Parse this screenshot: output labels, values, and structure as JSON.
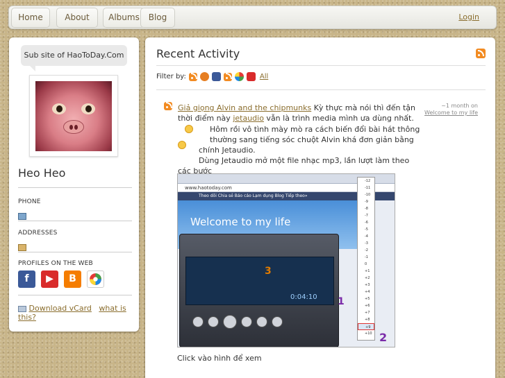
{
  "nav": {
    "items": [
      "Home",
      "About",
      "Albums",
      "Blog"
    ],
    "login": "Login"
  },
  "sidebar": {
    "site_note": "Sub site of HaoToDay.Com",
    "name": "Heo Heo",
    "phone_label": "PHONE",
    "addresses_label": "ADDRESSES",
    "profiles_label": "PROFILES ON THE WEB",
    "download_vcard": "Download vCard",
    "what_is_this": "what is this?"
  },
  "main": {
    "title": "Recent Activity",
    "filter_label": "Filter by:",
    "filter_all": "All"
  },
  "post": {
    "title_link": "Giả giọng Alvin and the chipmunks",
    "text1": " Kỳ thực mà nói thì đến tận thời điểm này ",
    "app_link": "jetaudio",
    "text2": " vẫn là trình media mình ưa dùng nhất.",
    "text3": "Hôm rồi vô tình mày mò ra cách biến đổi bài hát thông thường sang tiếng sóc chuột Alvin khá đơn giản bằng",
    "text4": "chính Jetaudio.",
    "text5": "Dùng Jetaudio mở một file nhạc mp3, lần lượt làm theo các bước",
    "time": "~1 month on",
    "via": "Welcome to my life",
    "caption": "Click vào hình để xem"
  },
  "screenshot": {
    "address": "www.haotoday.com",
    "welcome": "Welcome to my life",
    "bookmarks": "Theo dõi   Chia sẻ   Báo cáo Lạm dụng   Blog Tiếp theo»",
    "lcd_time": "0:04:10",
    "pitch_values": [
      "-12",
      "-11",
      "-10",
      "-9",
      "-8",
      "-7",
      "-6",
      "-5",
      "-4",
      "-3",
      "-2",
      "-1",
      "0",
      "+1",
      "+2",
      "+3",
      "+4",
      "+5",
      "+6",
      "+7",
      "+8",
      "+9",
      "+10"
    ],
    "annotations": [
      "1",
      "2",
      "3"
    ]
  },
  "colors": {
    "accent_link": "#8a6d2d",
    "rss": "#f28b22",
    "background": "#c8b589"
  }
}
